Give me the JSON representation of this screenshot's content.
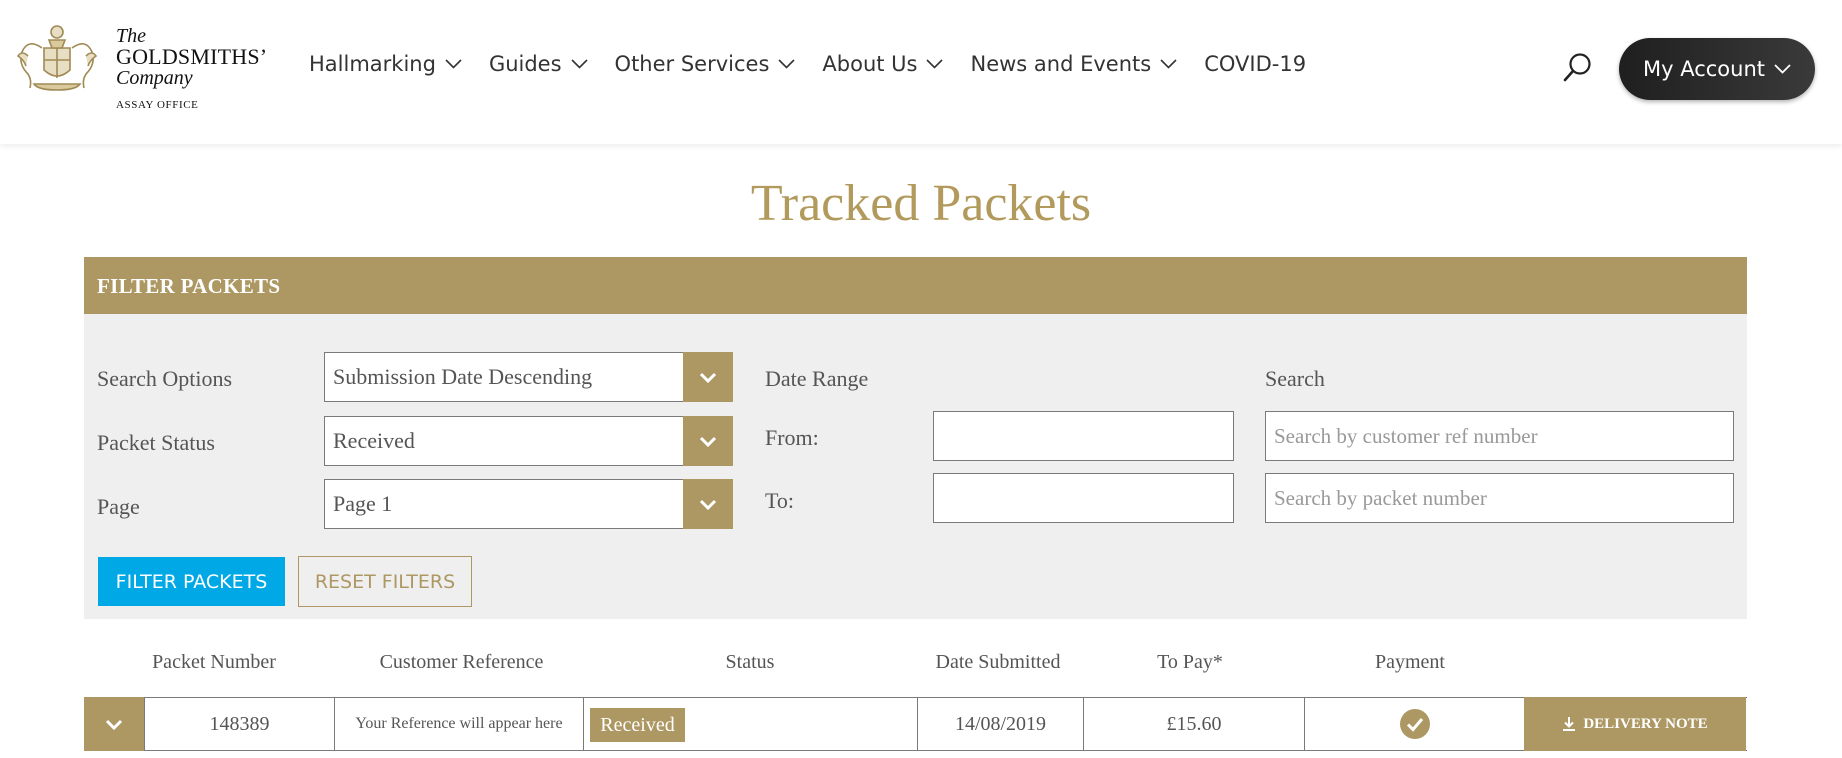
{
  "header": {
    "logo": {
      "line1": "The",
      "line2": "GOLDSMITHS’",
      "line3": "Company",
      "line4": "ASSAY OFFICE"
    },
    "nav": [
      {
        "label": "Hallmarking",
        "has_dropdown": true
      },
      {
        "label": "Guides",
        "has_dropdown": true
      },
      {
        "label": "Other Services",
        "has_dropdown": true
      },
      {
        "label": "About Us",
        "has_dropdown": true
      },
      {
        "label": "News and Events",
        "has_dropdown": true
      },
      {
        "label": "COVID-19",
        "has_dropdown": false
      }
    ],
    "search_icon": "search-icon",
    "account_label": "My Account"
  },
  "page_title": "Tracked Packets",
  "filter": {
    "heading": "FILTER PACKETS",
    "search_options_label": "Search Options",
    "search_options_value": "Submission Date Descending",
    "packet_status_label": "Packet Status",
    "packet_status_value": "Received",
    "page_label": "Page",
    "page_value": "Page 1",
    "date_range_label": "Date Range",
    "from_label": "From:",
    "from_value": "",
    "to_label": "To:",
    "to_value": "",
    "search_label": "Search",
    "customer_ref_placeholder": "Search by customer ref number",
    "packet_number_placeholder": "Search by packet number",
    "filter_button": "FILTER PACKETS",
    "reset_button": "RESET FILTERS"
  },
  "table": {
    "columns": [
      "Packet Number",
      "Customer Reference",
      "Status",
      "Date Submitted",
      "To Pay*",
      "Payment"
    ],
    "rows": [
      {
        "packet_number": "148389",
        "customer_reference": "Your Reference will appear here",
        "status": "Received",
        "date_submitted": "14/08/2019",
        "to_pay": "£15.60",
        "payment_icon": "check-circle-icon",
        "action": "DELIVERY NOTE"
      }
    ]
  },
  "colors": {
    "gold": "#ad9863",
    "title_gold": "#b19a5c",
    "blue": "#00a9e6",
    "panel_bg": "#efefef",
    "account_bg": "#2b2b2b"
  }
}
